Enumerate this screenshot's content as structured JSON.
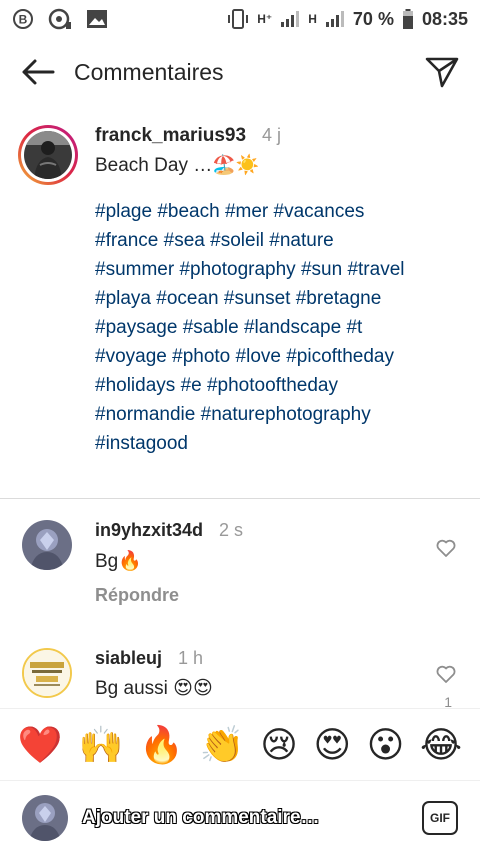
{
  "status_bar": {
    "network_1": "H⁺",
    "network_2": "H",
    "battery": "70 %",
    "time": "08:35"
  },
  "header": {
    "title": "Commentaires",
    "back_icon": "arrow-left-icon",
    "send_icon": "paper-plane-icon"
  },
  "caption": {
    "username": "franck_marius93",
    "time": "4 j",
    "text": "Beach Day …🏖️☀️",
    "hashtags": [
      "#plage",
      "#beach",
      "#mer",
      "#vacances",
      "#france",
      "#sea",
      "#soleil",
      "#nature",
      "#summer",
      "#photography",
      "#sun",
      "#travel",
      "#playa",
      "#ocean",
      "#sunset",
      "#bretagne",
      "#paysage",
      "#sable",
      "#landscape",
      "#t",
      "#voyage",
      "#photo",
      "#love",
      "#picoftheday",
      "#holidays",
      "#e",
      "#photooftheday",
      "#normandie",
      "#naturephotography",
      "#instagood"
    ]
  },
  "comments": [
    {
      "username": "in9yhzxit34d",
      "time": "2 s",
      "text": "Bg🔥",
      "reply": "Répondre",
      "likes": ""
    },
    {
      "username": "siableuj",
      "time": "1 h",
      "text": "Bg aussi 😍😍",
      "reply": "",
      "likes": "1"
    }
  ],
  "emoji_bar": [
    "❤️",
    "🙌",
    "🔥",
    "👏",
    "😢",
    "😍",
    "😮",
    "😂"
  ],
  "composer": {
    "placeholder": "Ajouter un commentaire…",
    "gif_label": "GIF"
  },
  "colors": {
    "hashtag": "#00376b",
    "muted": "#8e8e8e",
    "text": "#262626"
  }
}
